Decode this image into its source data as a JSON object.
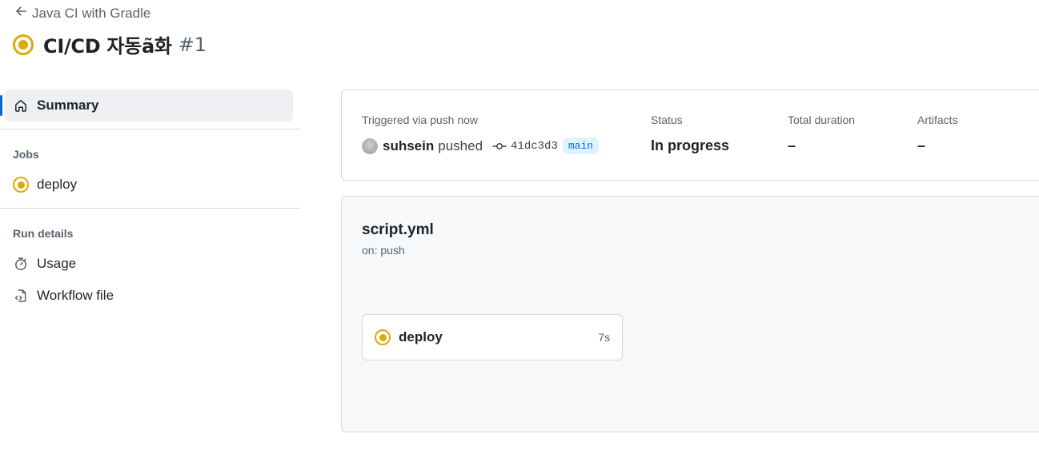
{
  "header": {
    "back_label": "Java CI with Gradle",
    "title": "CI/CD 자동ã화",
    "run_number": "#1"
  },
  "sidebar": {
    "summary_label": "Summary",
    "jobs_section": "Jobs",
    "jobs": [
      {
        "label": "deploy"
      }
    ],
    "run_details_section": "Run details",
    "usage_label": "Usage",
    "workflow_file_label": "Workflow file"
  },
  "summary": {
    "trigger_label": "Triggered via push now",
    "actor": "suhsein",
    "action": "pushed",
    "commit_sha": "41dc3d3",
    "branch": "main",
    "status_label": "Status",
    "status_value": "In progress",
    "duration_label": "Total duration",
    "duration_value": "–",
    "artifacts_label": "Artifacts",
    "artifacts_value": "–"
  },
  "workflow": {
    "file_name": "script.yml",
    "trigger": "on: push",
    "jobs": [
      {
        "name": "deploy",
        "duration": "7s"
      }
    ]
  },
  "colors": {
    "in_progress": "#dbab0a",
    "accent": "#0969da",
    "branch_bg": "#ddf4ff"
  }
}
